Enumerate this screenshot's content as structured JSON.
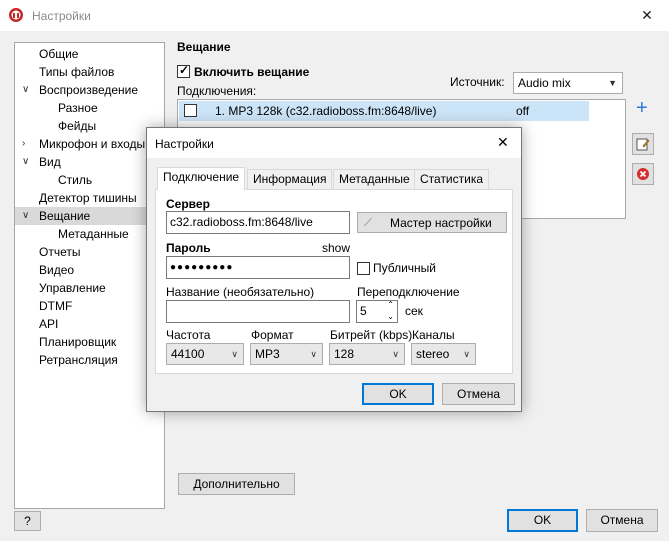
{
  "window": {
    "title": "Настройки",
    "close": "✕"
  },
  "tree": {
    "items": [
      {
        "label": "Общие"
      },
      {
        "label": "Типы файлов"
      },
      {
        "label": "Воспроизведение",
        "chev": "∨"
      },
      {
        "label": "Разное"
      },
      {
        "label": "Фейды"
      },
      {
        "label": "Микрофон и входы",
        "chev": "›"
      },
      {
        "label": "Вид",
        "chev": "∨"
      },
      {
        "label": "Стиль"
      },
      {
        "label": "Детектор тишины"
      },
      {
        "label": "Вещание",
        "chev": "∨"
      },
      {
        "label": "Метаданные"
      },
      {
        "label": "Отчеты"
      },
      {
        "label": "Видео"
      },
      {
        "label": "Управление"
      },
      {
        "label": "DTMF"
      },
      {
        "label": "API"
      },
      {
        "label": "Планировщик"
      },
      {
        "label": "Ретрансляция"
      }
    ]
  },
  "broadcast": {
    "title": "Вещание",
    "enable_label": "Включить вещание",
    "source_label": "Источник:",
    "source_value": "Audio mix",
    "connections_label": "Подключения:",
    "connection_row": {
      "name": "1. MP3 128k (c32.radioboss.fm:8648/live)",
      "status": "off"
    },
    "add_icon": "+",
    "advanced_button": "Дополнительно"
  },
  "footer": {
    "help": "?",
    "ok": "OK",
    "cancel": "Отмена"
  },
  "dialog": {
    "title": "Настройки",
    "close": "✕",
    "tabs": [
      "Подключение",
      "Информация",
      "Метаданные",
      "Статистика"
    ],
    "server_label": "Сервер",
    "server_value": "c32.radioboss.fm:8648/live",
    "wizard_button": "Мастер настройки",
    "password_label": "Пароль",
    "show_link": "show",
    "password_value": "●●●●●●●●●",
    "public_label": "Публичный",
    "name_label": "Название (необязательно)",
    "name_value": "",
    "reconnect_label": "Переподключение",
    "reconnect_value": "5",
    "reconnect_unit": "сек",
    "samplerate_label": "Частота",
    "samplerate_value": "44100",
    "format_label": "Формат",
    "format_value": "MP3",
    "bitrate_label": "Битрейт (kbps)",
    "bitrate_value": "128",
    "channels_label": "Каналы",
    "channels_value": "stereo",
    "ok": "OK",
    "cancel": "Отмена"
  }
}
